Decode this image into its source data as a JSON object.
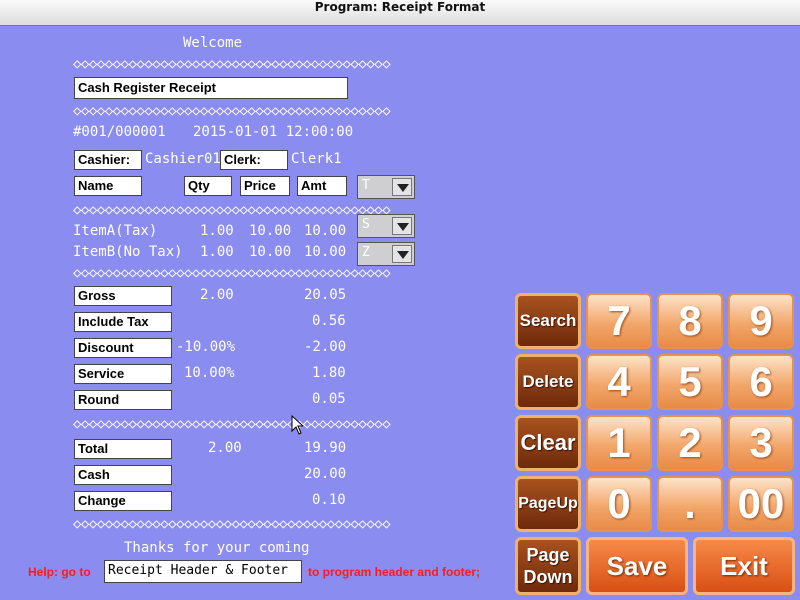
{
  "window": {
    "title": "Program: Receipt Format"
  },
  "receipt": {
    "welcome": "Welcome",
    "separator": "◇◇◇◇◇◇◇◇◇◇◇◇◇◇◇◇◇◇◇◇◇◇◇◇◇◇◇◇◇◇◇◇◇◇◇◇◇◇◇◇",
    "header_title": "Cash Register Receipt",
    "receipt_no": "#001/000001",
    "datetime": "2015-01-01 12:00:00",
    "cashier_label": "Cashier:",
    "cashier_value": "Cashier01",
    "clerk_label": "Clerk:",
    "clerk_value": "Clerk1",
    "col_name": "Name",
    "col_qty": "Qty",
    "col_price": "Price",
    "col_amt": "Amt",
    "combo_top": "T",
    "items": [
      {
        "name": "ItemA(Tax)",
        "qty": "1.00",
        "price": "10.00",
        "amt": "10.00",
        "combo": "S"
      },
      {
        "name": "ItemB(No Tax)",
        "qty": "1.00",
        "price": "10.00",
        "amt": "10.00",
        "combo": "Z"
      }
    ],
    "summary": [
      {
        "label": "Gross",
        "mid": "2.00",
        "value": "20.05"
      },
      {
        "label": "Include Tax",
        "mid": "",
        "value": "0.56"
      },
      {
        "label": "Discount",
        "mid": "-10.00%",
        "value": "-2.00"
      },
      {
        "label": "Service",
        "mid": "10.00%",
        "value": "1.80"
      },
      {
        "label": "Round",
        "mid": "",
        "value": "0.05"
      }
    ],
    "totals": [
      {
        "label": "Total",
        "mid": "2.00",
        "value": "19.90"
      },
      {
        "label": "Cash",
        "mid": "",
        "value": "20.00"
      },
      {
        "label": "Change",
        "mid": "",
        "value": "0.10"
      }
    ],
    "footer": "Thanks for your coming"
  },
  "help": {
    "prefix": "Help: go to",
    "input_value": "Receipt Header & Footer",
    "suffix": "to program header and footer;"
  },
  "keypad": {
    "search": "Search",
    "delete": "Delete",
    "clear": "Clear",
    "pageup": "PageUp",
    "pagedown": "Page\nDown",
    "k7": "7",
    "k8": "8",
    "k9": "9",
    "k4": "4",
    "k5": "5",
    "k6": "6",
    "k1": "1",
    "k2": "2",
    "k3": "3",
    "k0": "0",
    "kdot": ".",
    "k00": "00",
    "save": "Save",
    "exit": "Exit"
  },
  "colors": {
    "background": "#8a8cf0",
    "help_text": "#ff1a1a"
  }
}
